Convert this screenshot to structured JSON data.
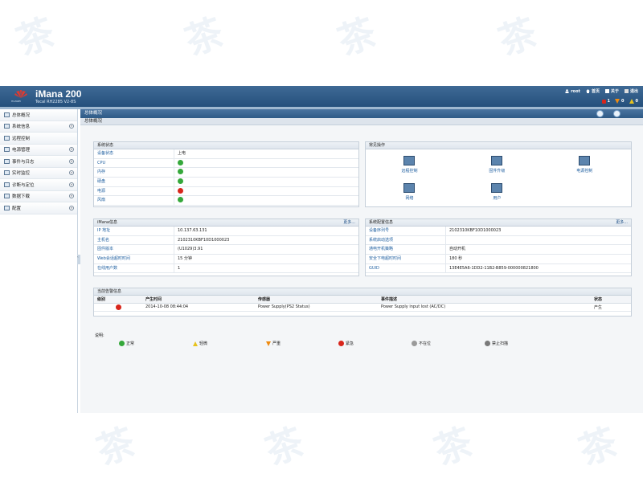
{
  "header": {
    "title": "iMana 200",
    "subtitle": "Tecal RH2285 V2-8S",
    "logo_text": "HUAWEI",
    "user": "root",
    "links": {
      "home": "首页",
      "about": "关于",
      "logout": "退出"
    },
    "alarm_counts": {
      "critical": "1",
      "major": "0",
      "minor": "0"
    }
  },
  "sidebar": {
    "items": [
      {
        "label": "总体概况",
        "expandable": false
      },
      {
        "label": "系统信息",
        "expandable": true
      },
      {
        "label": "远程控制",
        "expandable": false
      },
      {
        "label": "电源管理",
        "expandable": true
      },
      {
        "label": "事件与日志",
        "expandable": true
      },
      {
        "label": "实时监控",
        "expandable": true
      },
      {
        "label": "诊断与定位",
        "expandable": true
      },
      {
        "label": "数据下载",
        "expandable": true
      },
      {
        "label": "配置",
        "expandable": true
      }
    ]
  },
  "content": {
    "breadcrumb": "总体概况",
    "tab": "总体概况",
    "system_status": {
      "title": "系统状态",
      "rows": [
        {
          "key": "设备状态",
          "value": "上电",
          "status": ""
        },
        {
          "key": "CPU",
          "value": "",
          "status": "ok"
        },
        {
          "key": "内存",
          "value": "",
          "status": "ok"
        },
        {
          "key": "硬盘",
          "value": "",
          "status": "ok"
        },
        {
          "key": "电源",
          "value": "",
          "status": "critical"
        },
        {
          "key": "风扇",
          "value": "",
          "status": "ok"
        }
      ]
    },
    "common_ops": {
      "title": "常见操作",
      "items": [
        "远程控制",
        "固件升级",
        "电源控制",
        "网络",
        "用户"
      ]
    },
    "imana_info": {
      "title": "iMana信息",
      "more": "更多...",
      "rows": [
        {
          "key": "IP 地址",
          "value": "10.137.63.131"
        },
        {
          "key": "主机名",
          "value": "2102310KBF10D1000023"
        },
        {
          "key": "固件版本",
          "value": "(U1029)3.91"
        },
        {
          "key": "Web会话超时时间",
          "value": "15 分钟"
        },
        {
          "key": "在线用户数",
          "value": "1"
        }
      ]
    },
    "sys_config": {
      "title": "系统配置信息",
      "more": "更多...",
      "rows": [
        {
          "key": "设备序列号",
          "value": "2102310KBF10D1000023"
        },
        {
          "key": "系统启动选项",
          "value": ""
        },
        {
          "key": "通电开机策略",
          "value": "自动开机"
        },
        {
          "key": "安全下电超时时间",
          "value": "180 秒"
        },
        {
          "key": "GUID",
          "value": "13E4E5A6-1DD2-11B2-B859-000000821800"
        }
      ]
    },
    "current_alarms": {
      "title": "当前告警信息",
      "headers": [
        "级别",
        "产生时间",
        "传感器",
        "事件描述",
        "状态"
      ],
      "rows": [
        {
          "level": "critical",
          "time": "2014-10-08 08:44:04",
          "sensor": "Power Supply(PS2 Status)",
          "desc": "Power Supply input lost (AC/DC)",
          "state": "产生"
        }
      ]
    },
    "legend": {
      "label": "说明:",
      "items": [
        "正常",
        "轻微",
        "严重",
        "紧急",
        "不在位",
        "禁止扫描"
      ]
    }
  },
  "colors": {
    "header": "#2e5a86",
    "ok": "#35a83b",
    "critical": "#d8261c",
    "minor": "#e6c21e",
    "major": "#ef8b10"
  },
  "watermark": "茶"
}
